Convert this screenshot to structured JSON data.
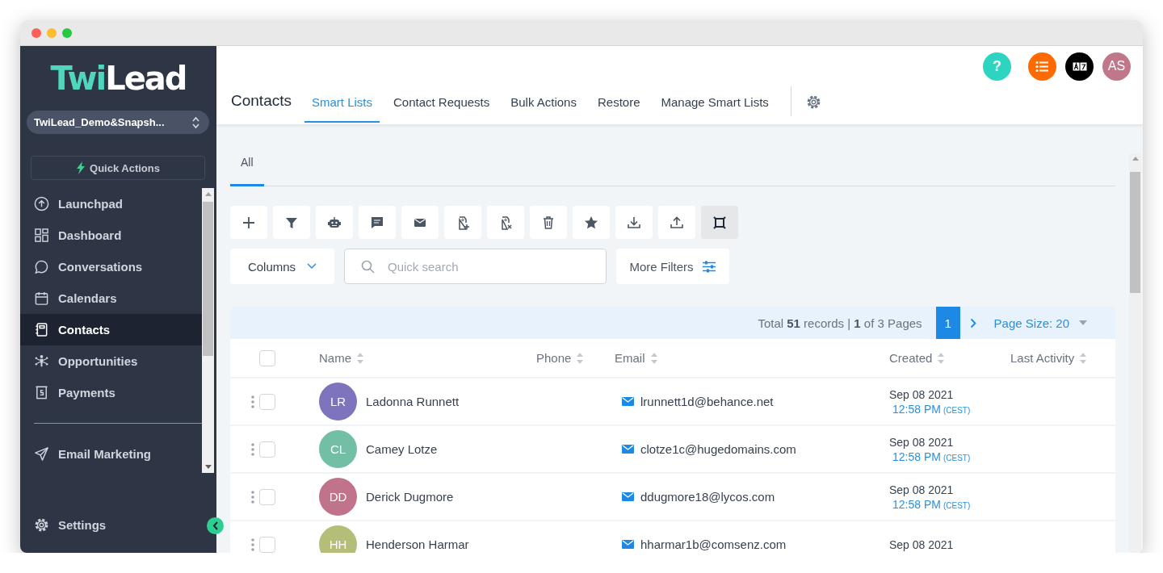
{
  "sidebar": {
    "logo": {
      "accent": "Twi",
      "rest": "Lead"
    },
    "location": "TwiLead_Demo&Snapsh...",
    "quick_actions": "Quick Actions",
    "items": [
      {
        "label": "Launchpad",
        "selected": false
      },
      {
        "label": "Dashboard",
        "selected": false
      },
      {
        "label": "Conversations",
        "selected": false
      },
      {
        "label": "Calendars",
        "selected": false
      },
      {
        "label": "Contacts",
        "selected": true
      },
      {
        "label": "Opportunities",
        "selected": false
      },
      {
        "label": "Payments",
        "selected": false
      }
    ],
    "extra_items": [
      {
        "label": "Email Marketing",
        "selected": false
      }
    ],
    "settings": "Settings"
  },
  "header": {
    "help": "?",
    "avatar": "AS",
    "title": "Contacts",
    "tabs": [
      {
        "label": "Smart Lists",
        "selected": true
      },
      {
        "label": "Contact Requests",
        "selected": false
      },
      {
        "label": "Bulk Actions",
        "selected": false
      },
      {
        "label": "Restore",
        "selected": false
      },
      {
        "label": "Manage Smart Lists",
        "selected": false
      }
    ]
  },
  "list_tabs": [
    {
      "label": "All",
      "selected": true
    }
  ],
  "toolbar": [
    {
      "selected": false
    },
    {
      "selected": false
    },
    {
      "selected": false
    },
    {
      "selected": false
    },
    {
      "selected": false
    },
    {
      "selected": false
    },
    {
      "selected": false
    },
    {
      "selected": false
    },
    {
      "selected": false
    },
    {
      "selected": false
    },
    {
      "selected": false
    },
    {
      "selected": true
    }
  ],
  "columns_button": "Columns",
  "search": {
    "placeholder": "Quick search"
  },
  "more_filters": "More Filters",
  "pagination": {
    "summary": "Total **51** records | **1** of 3 Pages",
    "current_page": "1",
    "page_size": "Page Size: 20"
  },
  "table": {
    "select_all": {
      "checked": false
    },
    "columns": [
      "Name",
      "Phone",
      "Email",
      "Created",
      "Last Activity"
    ],
    "rows": [
      {
        "checked": false,
        "initials": "LR",
        "color": "#7e74bd",
        "name": "Ladonna Runnett",
        "email": "lrunnett1d@behance.net",
        "date": "Sep 08 2021",
        "time": "12:58 PM",
        "timezone": "(CEST)"
      },
      {
        "checked": false,
        "initials": "CL",
        "color": "#73bfa5",
        "name": "Camey Lotze",
        "email": "clotze1c@hugedomains.com",
        "date": "Sep 08 2021",
        "time": "12:58 PM",
        "timezone": "(CEST)"
      },
      {
        "checked": false,
        "initials": "DD",
        "color": "#c0738a",
        "name": "Derick Dugmore",
        "email": "ddugmore18@lycos.com",
        "date": "Sep 08 2021",
        "time": "12:58 PM",
        "timezone": "(CEST)"
      },
      {
        "checked": false,
        "initials": "HH",
        "color": "#b4be78",
        "name": "Henderson Harmar",
        "email": "hharmar1b@comsenz.com",
        "date": "Sep 08 2021"
      }
    ]
  }
}
